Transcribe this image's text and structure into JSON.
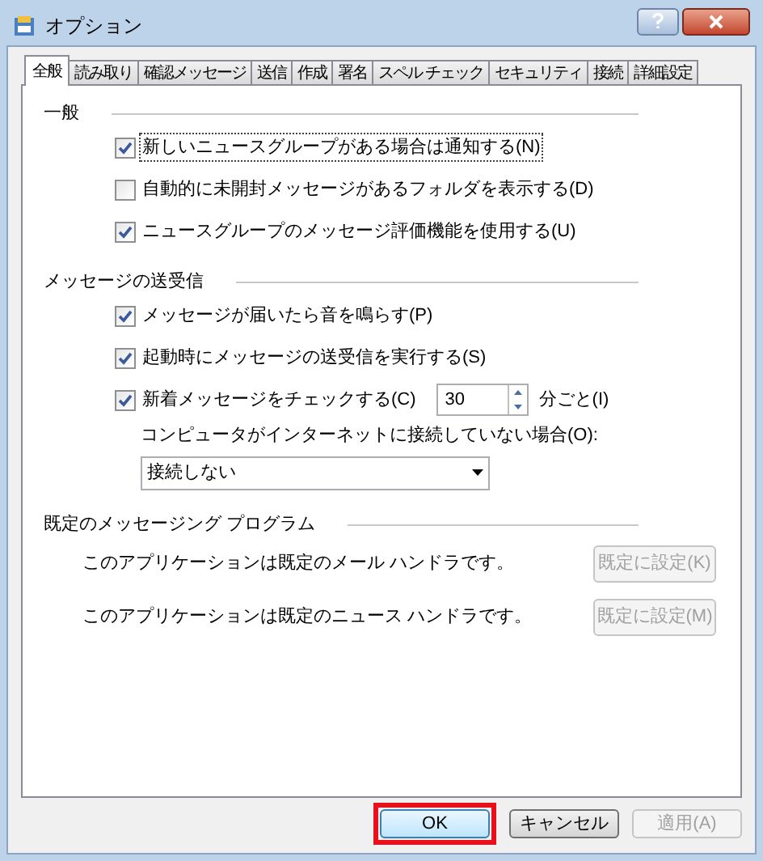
{
  "window": {
    "title": "オプション"
  },
  "tabs": [
    {
      "label": "全般",
      "selected": true
    },
    {
      "label": "読み取り",
      "selected": false
    },
    {
      "label": "確認メッセージ",
      "selected": false
    },
    {
      "label": "送信",
      "selected": false
    },
    {
      "label": "作成",
      "selected": false
    },
    {
      "label": "署名",
      "selected": false
    },
    {
      "label": "スペル チェック",
      "selected": false
    },
    {
      "label": "セキュリティ",
      "selected": false
    },
    {
      "label": "接続",
      "selected": false
    },
    {
      "label": "詳細設定",
      "selected": false
    }
  ],
  "sections": [
    {
      "title": "一般",
      "items": [
        {
          "kind": "checkbox",
          "label": "新しいニュースグループがある場合は通知する(N)",
          "checked": true,
          "focused": true
        },
        {
          "kind": "checkbox",
          "label": "自動的に未開封メッセージがあるフォルダを表示する(D)",
          "checked": false,
          "focused": false
        },
        {
          "kind": "checkbox",
          "label": "ニュースグループのメッセージ評価機能を使用する(U)",
          "checked": true,
          "focused": false
        }
      ]
    },
    {
      "title": "メッセージの送受信",
      "items": [
        {
          "kind": "checkbox",
          "label": "メッセージが届いたら音を鳴らす(P)",
          "checked": true,
          "focused": false
        },
        {
          "kind": "checkbox",
          "label": "起動時にメッセージの送受信を実行する(S)",
          "checked": true,
          "focused": false
        },
        {
          "kind": "spin",
          "label": "新着メッセージをチェックする(C)",
          "checked": true,
          "focused": false,
          "value": "30",
          "unit": "分ごと(I)"
        },
        {
          "kind": "label",
          "label": "コンピュータがインターネットに接続していない場合(O):"
        },
        {
          "kind": "dropdown",
          "value": "接続しない"
        }
      ]
    },
    {
      "title": "既定のメッセージング プログラム",
      "items": [
        {
          "kind": "default",
          "label": "このアプリケーションは既定のメール ハンドラです。",
          "button": "既定に設定(K)",
          "disabled": true
        },
        {
          "kind": "default",
          "label": "このアプリケーションは既定のニュース ハンドラです。",
          "button": "既定に設定(M)",
          "disabled": true
        }
      ]
    }
  ],
  "buttons": [
    {
      "label": "OK",
      "highlighted": true,
      "disabled": false
    },
    {
      "label": "キャンセル",
      "highlighted": false,
      "disabled": false
    },
    {
      "label": "適用(A)",
      "highlighted": false,
      "disabled": true
    }
  ]
}
